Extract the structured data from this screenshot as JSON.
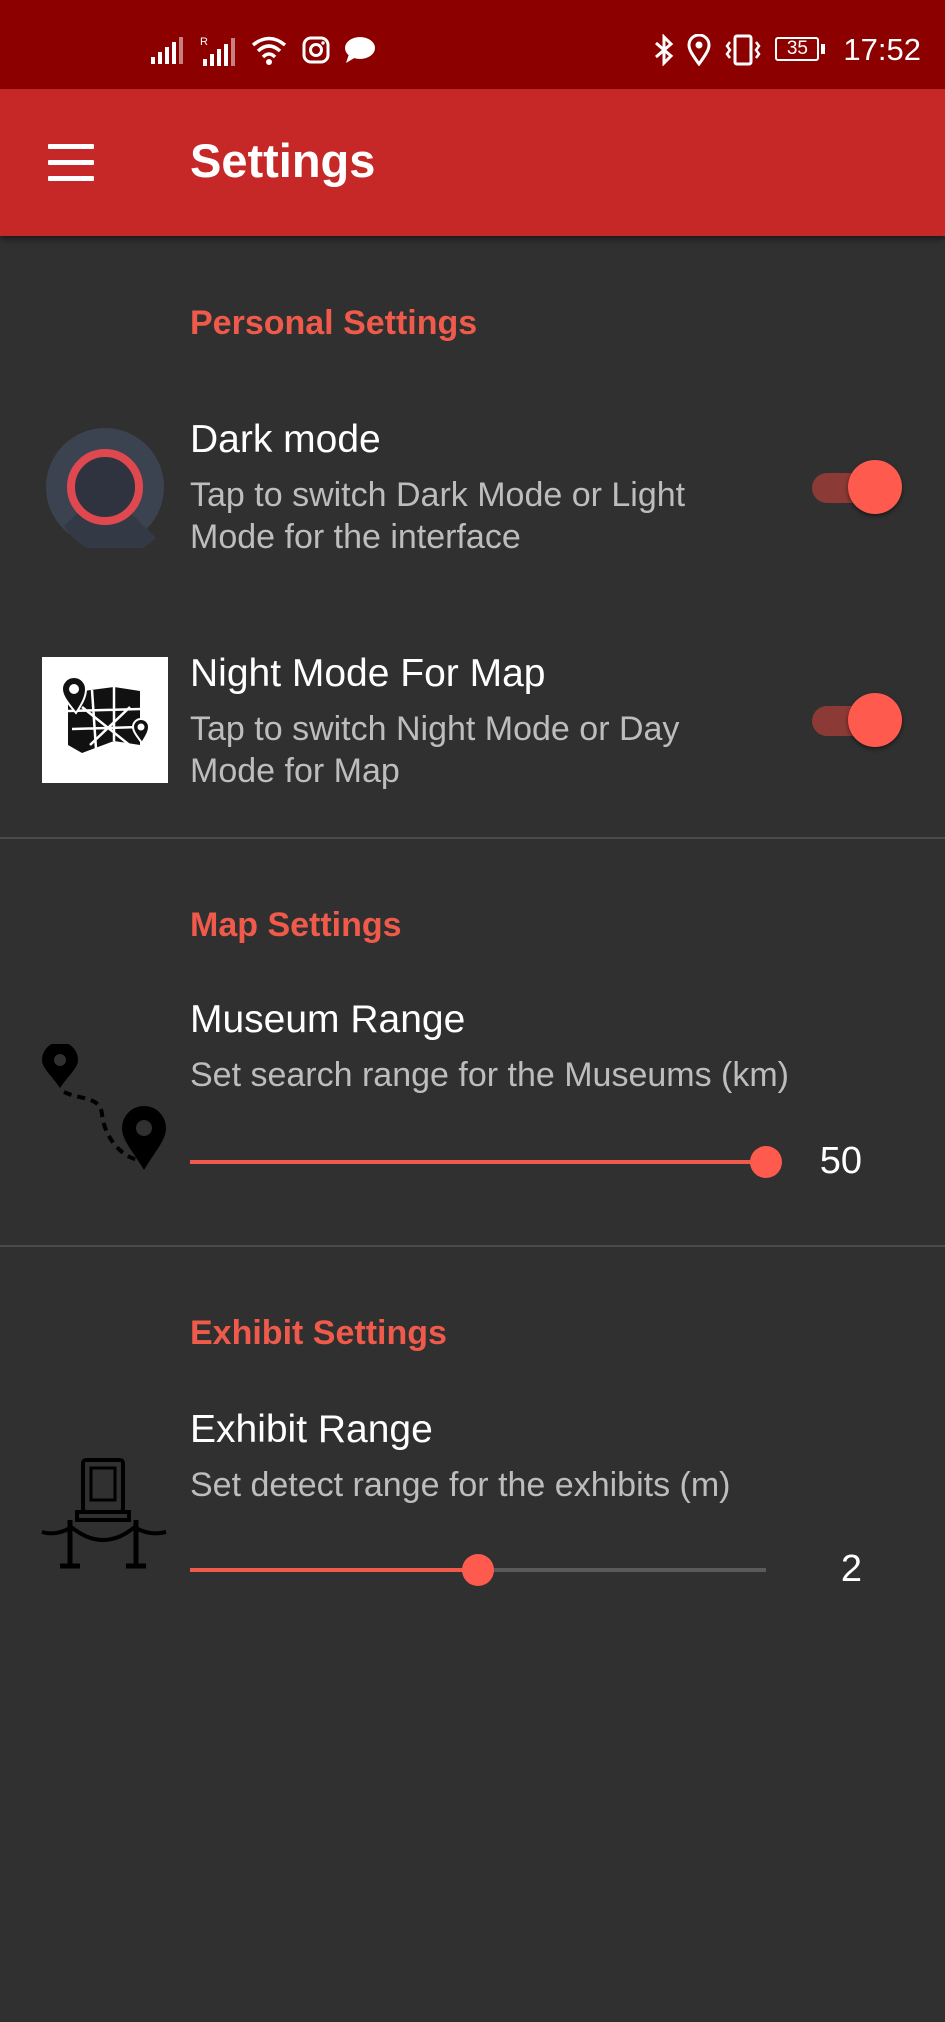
{
  "status_bar": {
    "time": "17:52",
    "battery": "35"
  },
  "app_bar": {
    "title": "Settings"
  },
  "sections": {
    "personal": {
      "title": "Personal Settings",
      "dark_mode": {
        "title": "Dark mode",
        "subtitle": "Tap to switch Dark Mode or Light Mode for the interface",
        "enabled": true
      },
      "night_map": {
        "title": "Night Mode For Map",
        "subtitle": "Tap to switch Night Mode or Day Mode for Map",
        "enabled": true
      }
    },
    "map": {
      "title": "Map Settings",
      "museum_range": {
        "title": "Museum Range",
        "subtitle": "Set search range for the Museums (km)",
        "value": "50",
        "fraction": 1.0
      }
    },
    "exhibit": {
      "title": "Exhibit Settings",
      "exhibit_range": {
        "title": "Exhibit Range",
        "subtitle": "Set detect range for the exhibits (m)",
        "value": "2",
        "fraction": 0.5
      }
    }
  },
  "colors": {
    "accent": "#ef5a4b",
    "app_bar": "#c62828",
    "status_bar": "#8c0000",
    "background": "#303030"
  },
  "icons": [
    "signal-icon",
    "signal-roaming-icon",
    "wifi-icon",
    "instagram-icon",
    "chat-icon",
    "bluetooth-icon",
    "location-icon",
    "vibrate-icon",
    "battery-icon",
    "menu-icon",
    "circle-theme-icon",
    "map-pin-icon",
    "route-pins-icon",
    "exhibit-stanchion-icon"
  ]
}
